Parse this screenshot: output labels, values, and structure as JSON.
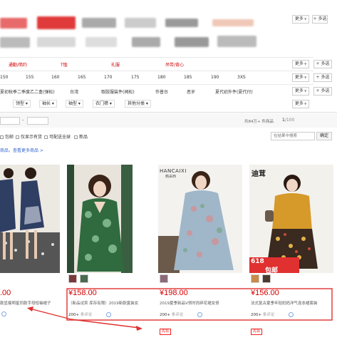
{
  "brand_row": {
    "more_label": "更多",
    "multi_label": "+ 多选"
  },
  "style_row": {
    "items": [
      "通勤/简约",
      "T恤",
      "礼服",
      "吊带/背心"
    ],
    "more_label": "更多",
    "multi_label": "+ 多选"
  },
  "size_row": {
    "items": [
      "150",
      "155",
      "160",
      "165",
      "170",
      "175",
      "180",
      "185",
      "190",
      "3XS"
    ],
    "more_label": "更多",
    "multi_label": "+ 多选"
  },
  "category_row": {
    "items": [
      "夏初秋季二季度乙二盒(弹松)",
      "台湾",
      "取胶服装件(阀松)",
      "作普台",
      "恶岁",
      "夏代初外件(夏代付)"
    ],
    "more_label": "更多",
    "multi_label": "+ 多选"
  },
  "filter_row": {
    "items": [
      "领型",
      "袖长",
      "袖型",
      "衣门襟",
      "其他分类"
    ],
    "more_label": "更多"
  },
  "price_filter": {
    "min_placeholder": "",
    "max_placeholder": "",
    "dash": "-"
  },
  "sort_bar": {
    "count_text": "共84万+ 件商品",
    "page_current": "1",
    "page_total": "/100"
  },
  "checkbox_row": {
    "options": [
      "包邮",
      "仅显示有货",
      "可配送全球",
      "新品"
    ],
    "search_placeholder": "在结果中搜索",
    "search_btn": "确定"
  },
  "breadcrumb": {
    "text": "商品，查看更多商品 >"
  },
  "products": [
    {
      "price": ".00",
      "title": "款显瘦明星同款字母短袖裙子",
      "sales": "",
      "tag": ""
    },
    {
      "price": "¥158.00",
      "title": "（新品试卖 库存有限）2019新款夏装女",
      "sales": "200+",
      "sales_sub": "条评论",
      "tag": ""
    },
    {
      "price": "¥198.00",
      "title": "2019夏季新品V领时尚碎花裙女修",
      "sales": "200+",
      "sales_sub": "条评论",
      "tag": "先领"
    },
    {
      "price": "¥156.00",
      "title": "法式复古夏季年轻妈妈洋气连衣裙套装",
      "sales": "200+",
      "sales_sub": "条评论",
      "tag": "先领"
    }
  ],
  "product3_brand": {
    "name": "HANCAIXI",
    "sub": "韩采西"
  },
  "product4_brand": {
    "name": "迪茸",
    "badge_618": "618",
    "badge_text": "包邮"
  },
  "colors": {
    "price_red": "#d40000",
    "annotation_red": "#e03030",
    "accent_blue": "#3366cc"
  }
}
